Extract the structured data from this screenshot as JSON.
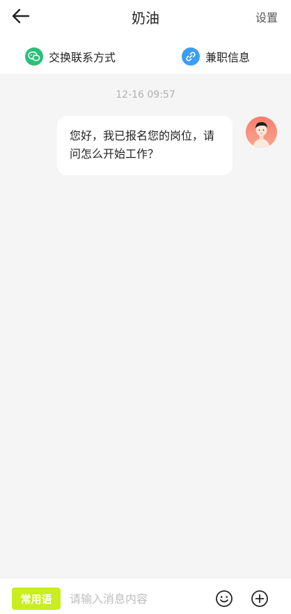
{
  "header": {
    "title": "奶油",
    "settings_label": "设置"
  },
  "actions": {
    "exchange_label": "交换联系方式",
    "job_info_label": "兼职信息"
  },
  "chat": {
    "timestamp": "12-16 09:57",
    "messages": [
      {
        "text": "您好，我已报名您的岗位，请问怎么开始工作？"
      }
    ]
  },
  "composer": {
    "phrases_label": "常用语",
    "input_placeholder": "请输入消息内容",
    "input_value": ""
  },
  "colors": {
    "phrases_button": "#c8ee1f",
    "wechat_icon": "#2bbf7a",
    "link_icon": "#3b9df5",
    "background": "#f5f5f5"
  },
  "icons": [
    "arrow-left-icon",
    "wechat-icon",
    "link-icon",
    "emoji-icon",
    "plus-circle-icon",
    "avatar"
  ]
}
